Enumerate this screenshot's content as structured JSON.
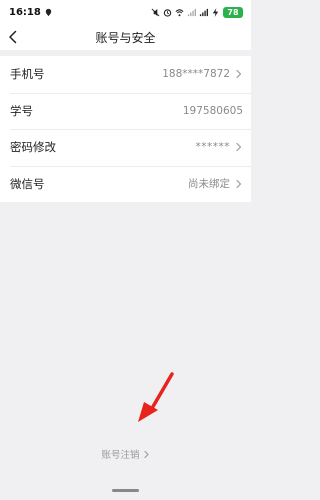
{
  "status_bar": {
    "time": "16:18",
    "battery": "78"
  },
  "nav": {
    "title": "账号与安全"
  },
  "rows": [
    {
      "label": "手机号",
      "value": "188****7872",
      "has_chevron": true
    },
    {
      "label": "学号",
      "value": "197580605",
      "has_chevron": false
    },
    {
      "label": "密码修改",
      "value": "******",
      "has_chevron": true
    },
    {
      "label": "微信号",
      "value": "尚未绑定",
      "has_chevron": true
    }
  ],
  "footer": {
    "cancel_label": "账号注销"
  },
  "colors": {
    "background": "#f0f0f3",
    "card": "#ffffff",
    "annotation_arrow": "#e8231c",
    "battery": "#2bb24c"
  }
}
